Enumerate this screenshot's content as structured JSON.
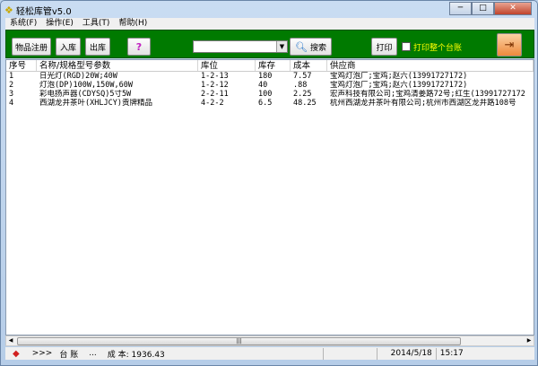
{
  "window": {
    "title": "轻松库管v5.0",
    "minimize": "─",
    "maximize": "□",
    "close": "✕"
  },
  "menu": [
    "系统(F)",
    "操作(E)",
    "工具(T)",
    "帮助(H)"
  ],
  "toolbar": {
    "register": "物品注册",
    "stock_in": "入库",
    "stock_out": "出库",
    "search_value": "",
    "search": "搜索",
    "print": "打印",
    "print_all_label": "打印整个台账",
    "print_all_checked": false
  },
  "table": {
    "columns": [
      "序号",
      "名称/规格型号参数",
      "库位",
      "库存",
      "成本",
      "供应商"
    ],
    "rows": [
      [
        "1",
        "日光灯(RGD)20W;40W",
        "1-2-13",
        "180",
        "7.57",
        "宝鸡灯泡厂;宝鸡;赵六(13991727172)"
      ],
      [
        "2",
        "灯泡(DP)100W,150W,60W",
        "1-2-12",
        "40",
        ".88",
        "宝鸡灯泡厂;宝鸡;赵六(13991727172)"
      ],
      [
        "3",
        "彩电扬声器(CDYSQ)5寸5W",
        "2-2-11",
        "100",
        "2.25",
        "宏声科技有限公司;宝鸡清姜路72号;红生(13991727172"
      ],
      [
        "4",
        "西湖龙井茶叶(XHLJCY)贡牌精品",
        "4-2-2",
        "6.5",
        "48.25",
        "杭州西湖龙井茶叶有限公司;杭州市西湖区龙井路108号"
      ]
    ]
  },
  "status": {
    "arrows": ">>>",
    "ledger": "台 账",
    "dots": "...",
    "cost": "成 本: 1936.43",
    "date": "2014/5/18",
    "time": "15:17"
  }
}
